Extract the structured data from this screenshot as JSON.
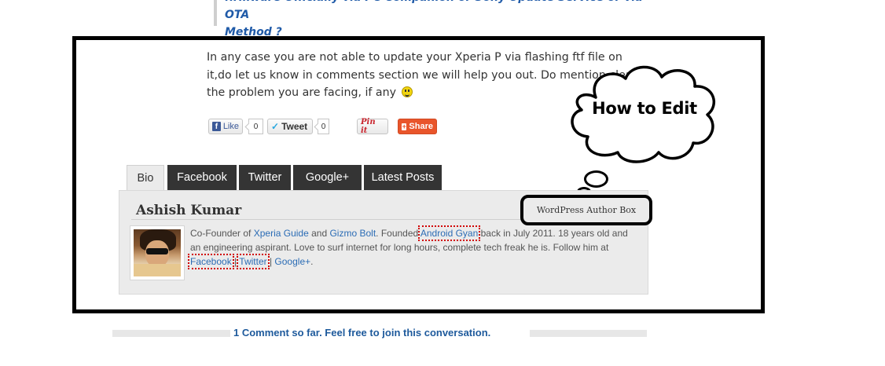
{
  "top_heading": {
    "line1": "firmware Officially via PC Companion or Sony Update Service or via OTA",
    "line2": "Method ?"
  },
  "post": {
    "paragraph": "In any case you are not able to update your Xperia P via flashing ftf file on it,do let us know in comments section we will help you out. Do mention clearly the problem you are facing, if any"
  },
  "share": {
    "fb_label": "Like",
    "fb_count": "0",
    "tw_label": "Tweet",
    "tw_count": "0",
    "pin_label": "Pin it",
    "share_label": "Share"
  },
  "annotation": {
    "cloud_text": "How to Edit",
    "author_box_label": "WordPress Author Box"
  },
  "author_box": {
    "tabs": [
      "Bio",
      "Facebook",
      "Twitter",
      "Google+",
      "Latest Posts"
    ],
    "active_tab": "Bio",
    "name": "Ashish Kumar",
    "bio": {
      "t1": "Co-Founder of ",
      "link_xperia": "Xperia Guide",
      "t2": " and ",
      "link_gizmo": "Gizmo Bolt",
      "t3": ". Founded ",
      "link_android": "Android Gyan",
      "t4": " back in July 2011. 18 years old and an engineering aspirant. Love to surf internet for long hours, complete tech freak he is. Follow him at ",
      "link_facebook": "Facebook",
      "sep1": " | ",
      "link_twitter": "Twitter",
      "sep2": " | ",
      "link_google": "Google+",
      "t5": "."
    }
  },
  "comments": {
    "text": "1 Comment so far. Feel free to join this conversation."
  },
  "colors": {
    "link": "#2b6cb5",
    "tab_dark": "#343434",
    "share_orange": "#e9552b",
    "annotation_dotted": "#d10000"
  }
}
